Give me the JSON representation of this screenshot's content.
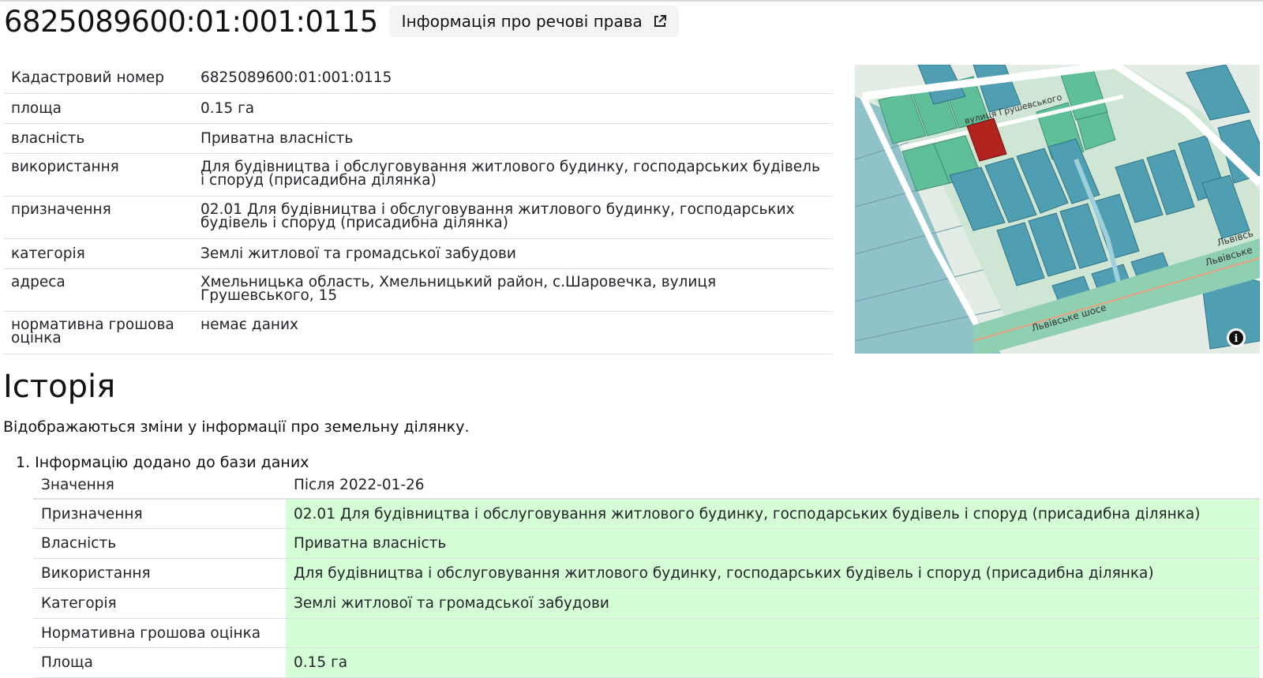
{
  "parcel": {
    "cadastral_number": "6825089600:01:001:0115",
    "rights_button_label": "Інформація про речові права"
  },
  "info_rows": [
    {
      "key": "Кадастровий номер",
      "value": "6825089600:01:001:0115"
    },
    {
      "key": "площа",
      "value": "0.15 га"
    },
    {
      "key": "власність",
      "value": "Приватна власність"
    },
    {
      "key": "використання",
      "value": "Для будівництва і обслуговування житлового будинку, господарських будівель і споруд (присадибна ділянка)"
    },
    {
      "key": "призначення",
      "value": "02.01 Для будівництва і обслуговування житлового будинку, господарських будівель і споруд (присадибна ділянка)"
    },
    {
      "key": "категорія",
      "value": "Землі житлової та громадської забудови"
    },
    {
      "key": "адреса",
      "value": "Хмельницька область, Хмельницький район, с.Шаровечка, вулиця Грушевського, 15"
    },
    {
      "key": "нормативна грошова оцінка",
      "value": "немає даних"
    }
  ],
  "map": {
    "street_label_1": "вулиця Грушевського",
    "street_label_2": "Львівське шосе",
    "street_label_3": "Львівське",
    "street_label_4": "Львівсь",
    "info_button": "i",
    "colors": {
      "selected_parcel": "#b3241f",
      "parcel_green": "#5fbf98",
      "parcel_teal": "#4f9eb1",
      "background": "#e4ece6",
      "road": "#ffffff"
    }
  },
  "history": {
    "title": "Історія",
    "description": "Відображаються зміни у інформації про земельну ділянку.",
    "items": [
      {
        "title": "1. Інформацію додано до бази даних",
        "header": {
          "key": "Значення",
          "value": "Після 2022-01-26"
        },
        "rows": [
          {
            "key": "Призначення",
            "value": "02.01 Для будівництва і обслуговування житлового будинку, господарських будівель і споруд (присадибна ділянка)"
          },
          {
            "key": "Власність",
            "value": "Приватна власність"
          },
          {
            "key": "Використання",
            "value": "Для будівництва і обслуговування житлового будинку, господарських будівель і споруд (присадибна ділянка)"
          },
          {
            "key": "Категорія",
            "value": "Землі житлової та громадської забудови"
          },
          {
            "key": "Нормативна грошова оцінка",
            "value": ""
          },
          {
            "key": "Площа",
            "value": "0.15 га"
          }
        ]
      }
    ]
  }
}
